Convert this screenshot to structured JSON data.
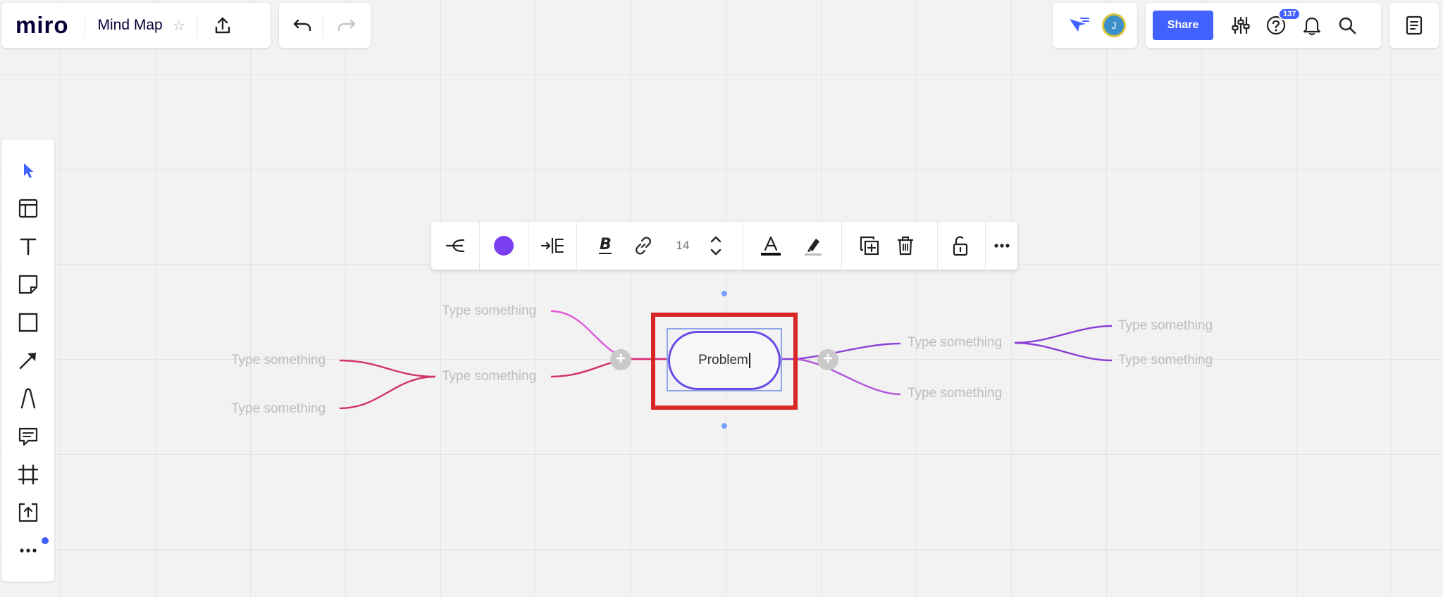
{
  "header": {
    "logo": "miro",
    "board_name": "Mind Map",
    "star": "☆",
    "share_label": "Share",
    "help_badge": "137",
    "avatar_initial": "J"
  },
  "toolbar_left": {
    "tools": [
      "select",
      "templates",
      "text",
      "sticky-note",
      "shape",
      "connection-line",
      "pen",
      "comment",
      "frame",
      "upload",
      "more"
    ]
  },
  "context_toolbar": {
    "font_size": "14",
    "node_color": "#7b3ff2",
    "tools": [
      "mindmap-direction",
      "node-color",
      "layout",
      "bold",
      "link",
      "font-size",
      "text-color",
      "highlight",
      "duplicate",
      "delete",
      "lock",
      "more"
    ]
  },
  "mindmap": {
    "center": "Problem",
    "placeholder": "Type something",
    "nodes": [
      "Type something",
      "Type something",
      "Type something",
      "Type something",
      "Type something",
      "Type something",
      "Type something",
      "Type something"
    ]
  },
  "colors": {
    "accent": "#4262ff",
    "node_border": "#6a4be8",
    "highlight": "#d92626",
    "branch_left_a": "#e05bd9",
    "branch_left_b": "#d1306f",
    "branch_right": "#8a3fd8"
  }
}
